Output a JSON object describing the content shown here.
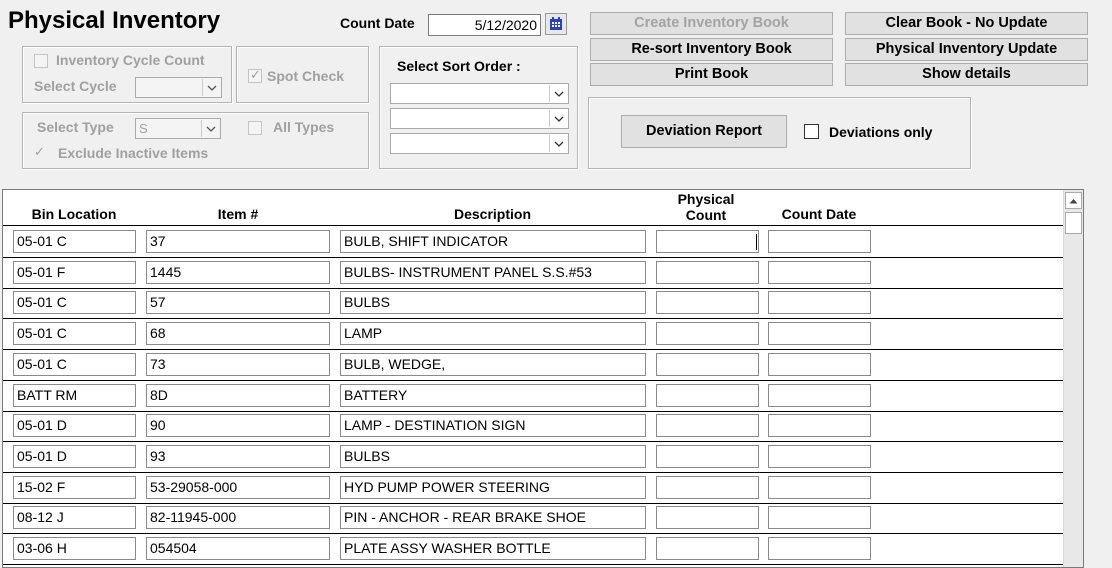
{
  "window": {
    "title": "Physical Inventory"
  },
  "count_date": {
    "label": "Count Date",
    "value": "5/12/2020"
  },
  "buttons": {
    "create_book": "Create Inventory Book",
    "clear_book": "Clear Book - No Update",
    "resort_book": "Re-sort Inventory Book",
    "update": "Physical Inventory Update",
    "print_book": "Print Book",
    "show_details": "Show details",
    "deviation_report": "Deviation Report"
  },
  "cycle": {
    "cycle_count_label": "Inventory Cycle Count",
    "select_cycle_label": "Select Cycle",
    "select_cycle_value": ""
  },
  "spot_check": {
    "label": "Spot Check",
    "checked": true
  },
  "type": {
    "select_type_label": "Select Type",
    "select_type_value": "S",
    "all_types_label": "All Types",
    "exclude_inactive_label": "Exclude Inactive Items"
  },
  "sort_order": {
    "label": "Select Sort Order :",
    "options": [
      "",
      "",
      ""
    ]
  },
  "deviations": {
    "only_label": "Deviations only",
    "checked": false
  },
  "grid": {
    "headers": {
      "bin_location": "Bin Location",
      "item": "Item #",
      "description": "Description",
      "physical_count_1": "Physical",
      "physical_count_2": "Count",
      "count_date": "Count Date"
    },
    "rows": [
      {
        "bin": "05-01 C",
        "item": "37",
        "description": "BULB, SHIFT INDICATOR",
        "count": "",
        "date": ""
      },
      {
        "bin": "05-01 F",
        "item": "1445",
        "description": "BULBS- INSTRUMENT PANEL S.S.#53",
        "count": "",
        "date": ""
      },
      {
        "bin": "05-01 C",
        "item": "57",
        "description": "BULBS",
        "count": "",
        "date": ""
      },
      {
        "bin": "05-01 C",
        "item": "68",
        "description": "LAMP",
        "count": "",
        "date": ""
      },
      {
        "bin": "05-01 C",
        "item": "73",
        "description": "BULB, WEDGE,",
        "count": "",
        "date": ""
      },
      {
        "bin": "BATT RM",
        "item": "8D",
        "description": "BATTERY",
        "count": "",
        "date": ""
      },
      {
        "bin": "05-01 D",
        "item": "90",
        "description": "LAMP - DESTINATION SIGN",
        "count": "",
        "date": ""
      },
      {
        "bin": "05-01 D",
        "item": "93",
        "description": "BULBS",
        "count": "",
        "date": ""
      },
      {
        "bin": "15-02 F",
        "item": "53-29058-000",
        "description": "HYD PUMP POWER STEERING",
        "count": "",
        "date": ""
      },
      {
        "bin": "08-12 J",
        "item": "82-11945-000",
        "description": "PIN - ANCHOR - REAR BRAKE SHOE",
        "count": "",
        "date": ""
      },
      {
        "bin": "03-06 H",
        "item": "054504",
        "description": "PLATE ASSY WASHER BOTTLE",
        "count": "",
        "date": ""
      }
    ]
  }
}
